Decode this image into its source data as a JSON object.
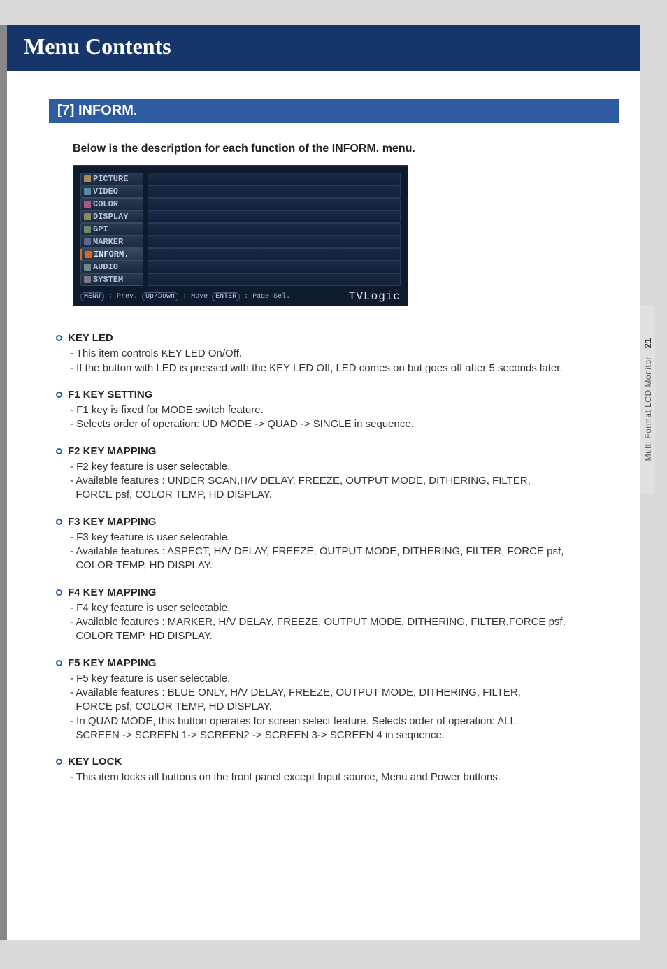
{
  "page": {
    "title": "Menu Contents",
    "section": "[7] INFORM.",
    "intro": "Below is the description for each function of the INFORM. menu."
  },
  "side_tab": {
    "label": "Multi Format LCD Monitor",
    "page": "21"
  },
  "osd": {
    "tabs": [
      {
        "label": "PICTURE",
        "selected": false,
        "icon_color": "#a88a5a"
      },
      {
        "label": "VIDEO",
        "selected": false,
        "icon_color": "#5a8aa8"
      },
      {
        "label": "COLOR",
        "selected": false,
        "icon_color": "#a85a7a"
      },
      {
        "label": "DISPLAY",
        "selected": false,
        "icon_color": "#8a8a5a"
      },
      {
        "label": "GPI",
        "selected": false,
        "icon_color": "#6a8a6a"
      },
      {
        "label": "MARKER",
        "selected": false,
        "icon_color": "#5a6a8a"
      },
      {
        "label": "INFORM.",
        "selected": true,
        "icon_color": "#d86a1f"
      },
      {
        "label": "AUDIO",
        "selected": false,
        "icon_color": "#6a8a8a"
      },
      {
        "label": "SYSTEM",
        "selected": false,
        "icon_color": "#7a7a8a"
      }
    ],
    "footer": {
      "menu_pill": "MENU",
      "menu_label": ": Prev.",
      "updown_pill": "Up/Down",
      "updown_label": ": Move",
      "enter_pill": "ENTER",
      "enter_label": ": Page Sel."
    },
    "brand": "TVLogic"
  },
  "items": [
    {
      "title": "KEY LED",
      "lines": [
        "-  This item controls KEY LED On/Off.",
        "- If the button with LED is pressed with the KEY LED Off, LED comes on but goes off after 5 seconds later."
      ]
    },
    {
      "title": "F1 KEY SETTING",
      "lines": [
        "- F1 key is fixed for MODE switch feature.",
        "- Selects order of operation: UD MODE -> QUAD -> SINGLE in sequence."
      ]
    },
    {
      "title": "F2 KEY MAPPING",
      "lines": [
        "- F2 key feature is user selectable.",
        "- Available features : UNDER SCAN,H/V DELAY, FREEZE, OUTPUT MODE, DITHERING, FILTER,",
        "  FORCE psf, COLOR TEMP, HD DISPLAY."
      ]
    },
    {
      "title": "F3 KEY MAPPING",
      "lines": [
        "- F3 key feature is user selectable.",
        "- Available features : ASPECT, H/V DELAY, FREEZE, OUTPUT MODE, DITHERING, FILTER, FORCE psf,",
        "  COLOR TEMP, HD DISPLAY."
      ]
    },
    {
      "title": "F4 KEY MAPPING",
      "lines": [
        "- F4 key feature is user selectable.",
        "- Available features : MARKER, H/V DELAY, FREEZE, OUTPUT MODE, DITHERING, FILTER,FORCE psf,",
        "  COLOR TEMP, HD DISPLAY."
      ]
    },
    {
      "title": "F5 KEY MAPPING",
      "lines": [
        "- F5 key feature is user selectable.",
        "- Available features : BLUE ONLY, H/V DELAY, FREEZE, OUTPUT MODE, DITHERING, FILTER,",
        "  FORCE psf, COLOR TEMP, HD DISPLAY.",
        "- In QUAD MODE, this button operates for screen select feature. Selects order of operation: ALL",
        "  SCREEN -> SCREEN 1-> SCREEN2 -> SCREEN 3-> SCREEN 4 in sequence."
      ]
    },
    {
      "title": "KEY LOCK",
      "lines": [
        "- This item locks all buttons on the front panel except Input source, Menu and Power buttons."
      ]
    }
  ]
}
